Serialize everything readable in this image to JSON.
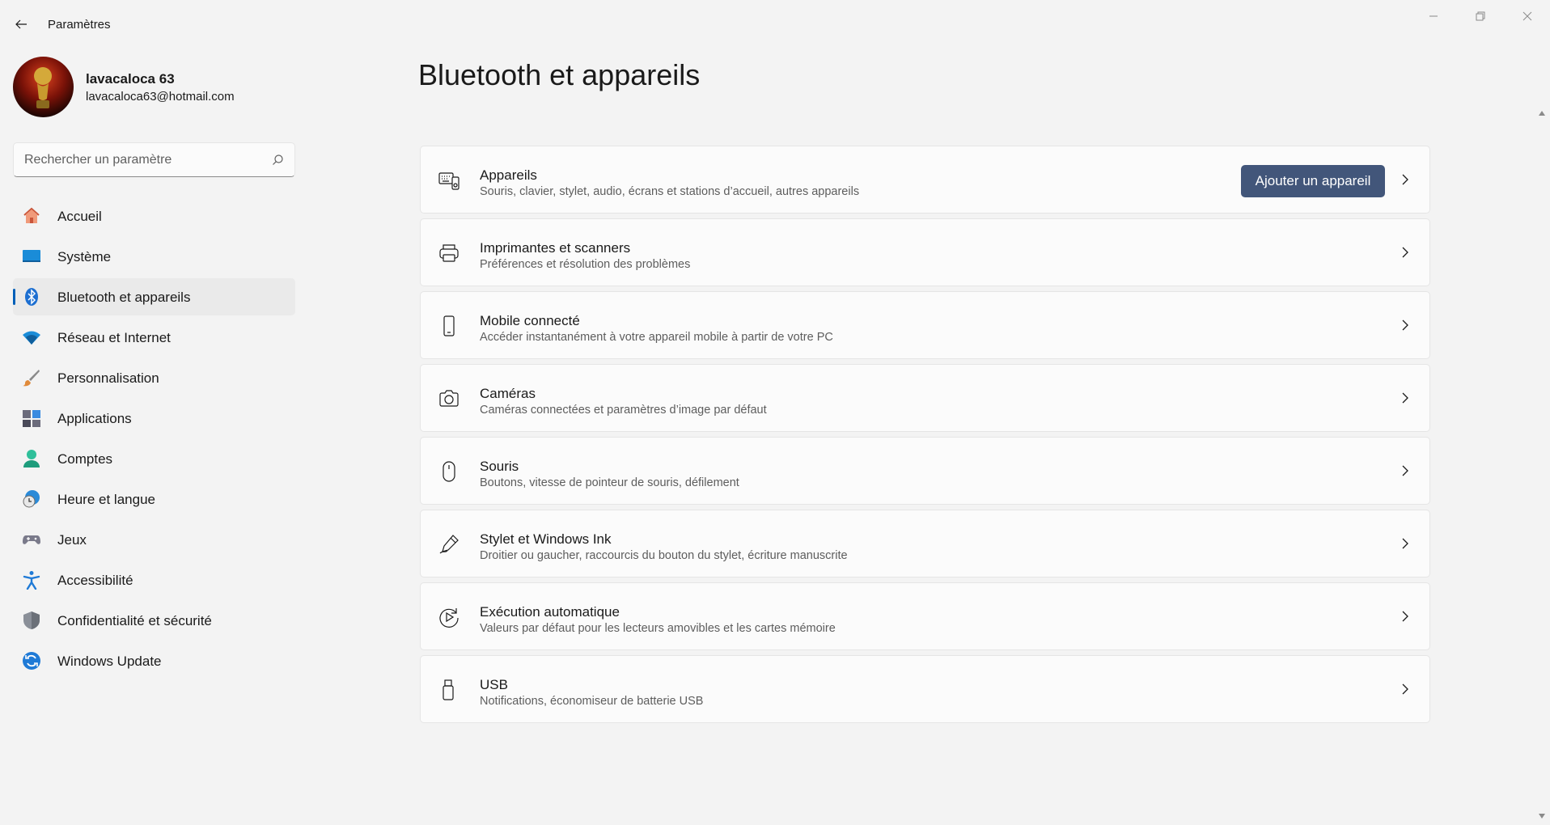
{
  "window": {
    "title": "Paramètres"
  },
  "profile": {
    "name": "lavacaloca 63",
    "email": "lavacaloca63@hotmail.com"
  },
  "search": {
    "placeholder": "Rechercher un paramètre"
  },
  "sidebar": {
    "items": [
      {
        "label": "Accueil",
        "icon": "home-icon"
      },
      {
        "label": "Système",
        "icon": "system-icon"
      },
      {
        "label": "Bluetooth et appareils",
        "icon": "bluetooth-icon",
        "active": true
      },
      {
        "label": "Réseau et Internet",
        "icon": "wifi-icon"
      },
      {
        "label": "Personnalisation",
        "icon": "brush-icon"
      },
      {
        "label": "Applications",
        "icon": "apps-icon"
      },
      {
        "label": "Comptes",
        "icon": "account-icon"
      },
      {
        "label": "Heure et langue",
        "icon": "globe-clock-icon"
      },
      {
        "label": "Jeux",
        "icon": "gamepad-icon"
      },
      {
        "label": "Accessibilité",
        "icon": "accessibility-icon"
      },
      {
        "label": "Confidentialité et sécurité",
        "icon": "shield-icon"
      },
      {
        "label": "Windows Update",
        "icon": "update-icon"
      }
    ]
  },
  "main": {
    "title": "Bluetooth et appareils",
    "add_device_label": "Ajouter un appareil",
    "cards": [
      {
        "title": "Appareils",
        "subtitle": "Souris, clavier, stylet, audio, écrans et stations d’accueil, autres appareils",
        "icon": "devices-icon"
      },
      {
        "title": "Imprimantes et scanners",
        "subtitle": "Préférences et résolution des problèmes",
        "icon": "printer-icon"
      },
      {
        "title": "Mobile connecté",
        "subtitle": "Accéder instantanément à votre appareil mobile à partir de votre PC",
        "icon": "phone-icon"
      },
      {
        "title": "Caméras",
        "subtitle": "Caméras connectées et paramètres d’image par défaut",
        "icon": "camera-icon"
      },
      {
        "title": "Souris",
        "subtitle": "Boutons, vitesse de pointeur de souris, défilement",
        "icon": "mouse-icon"
      },
      {
        "title": "Stylet et Windows Ink",
        "subtitle": "Droitier ou gaucher, raccourcis du bouton du stylet, écriture manuscrite",
        "icon": "pen-icon"
      },
      {
        "title": "Exécution automatique",
        "subtitle": "Valeurs par défaut pour les lecteurs amovibles et les cartes mémoire",
        "icon": "autoplay-icon"
      },
      {
        "title": "USB",
        "subtitle": "Notifications, économiseur de batterie USB",
        "icon": "usb-icon"
      }
    ]
  },
  "colors": {
    "accent": "#005fb8",
    "button": "#42567a",
    "background": "#f3f3f3",
    "card": "#fbfbfb"
  }
}
